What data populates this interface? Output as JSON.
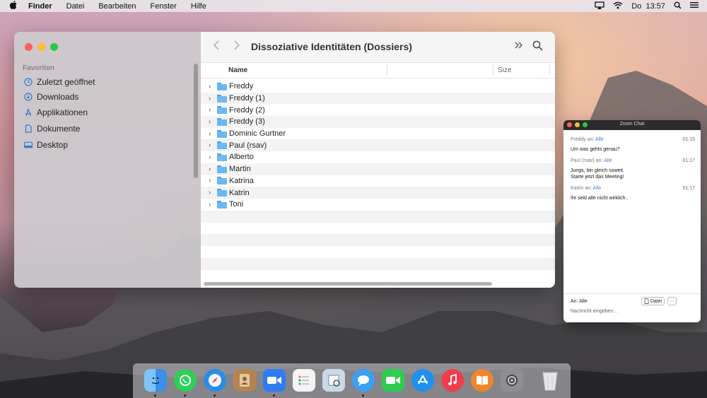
{
  "menubar": {
    "app": "Finder",
    "menus": [
      "Datei",
      "Bearbeiten",
      "Fenster",
      "Hilfe"
    ],
    "clock": "Do  13:57"
  },
  "finder": {
    "title": "Dissoziative Identitäten (Dossiers)",
    "sidebar": {
      "section": "Favoriten",
      "items": [
        {
          "label": "Zuletzt geöffnet",
          "icon": "clock-icon"
        },
        {
          "label": "Downloads",
          "icon": "download-icon"
        },
        {
          "label": "Applikationen",
          "icon": "apps-icon"
        },
        {
          "label": "Dokumente",
          "icon": "document-icon"
        },
        {
          "label": "Desktop",
          "icon": "desktop-icon"
        }
      ]
    },
    "columns": {
      "name": "Name",
      "size": "Size"
    },
    "folders": [
      "Freddy",
      "Freddy (1)",
      "Freddy (2)",
      "Freddy (3)",
      "Dominic Gurtner",
      "Paul (rsav)",
      "Alberto",
      "Martin",
      "Katrina",
      "Katrin",
      "Toni"
    ]
  },
  "zoom_chat": {
    "title": "Zoom Chat",
    "messages": [
      {
        "from": "Freddy an:",
        "to": "Alle",
        "time": "01:15",
        "text": "Um was gehts genau?"
      },
      {
        "from": "Paul (rsav) an:",
        "to": "Alle",
        "time": "01:17",
        "text": "Jungs, bin gleich soweit.\nStarte jetzt das Meeting!"
      },
      {
        "from": "Katrin an:",
        "to": "Alle",
        "time": "01:17",
        "text": "Ihr seid alle nicht wirklich.."
      }
    ],
    "recipient": "An: Alle",
    "file_button": "Datei",
    "more_button": "···",
    "placeholder": "Nachricht eingeben..."
  },
  "dock": {
    "apps": [
      {
        "icon": "finder-icon",
        "color": "#3d8ee8"
      },
      {
        "icon": "whatsapp-icon",
        "color": "#2fcf57"
      },
      {
        "icon": "safari-icon",
        "color": "#2a8ce8"
      },
      {
        "icon": "contacts-icon",
        "color": "#b58352"
      },
      {
        "icon": "zoom-icon",
        "color": "#2d7cf6"
      },
      {
        "icon": "reminders-icon",
        "color": "#f4f4f4"
      },
      {
        "icon": "preview-icon",
        "color": "#c9d9e6"
      },
      {
        "icon": "messages-icon",
        "color": "#3aa0f3"
      },
      {
        "icon": "facetime-icon",
        "color": "#2fcc4f"
      },
      {
        "icon": "appstore-icon",
        "color": "#1f8ff0"
      },
      {
        "icon": "music-icon",
        "color": "#f23c4a"
      },
      {
        "icon": "books-icon",
        "color": "#f0862a"
      },
      {
        "icon": "settings-icon",
        "color": "#8e8e93"
      },
      {
        "icon": "trash-icon",
        "color": "#dcdcdf"
      }
    ]
  }
}
